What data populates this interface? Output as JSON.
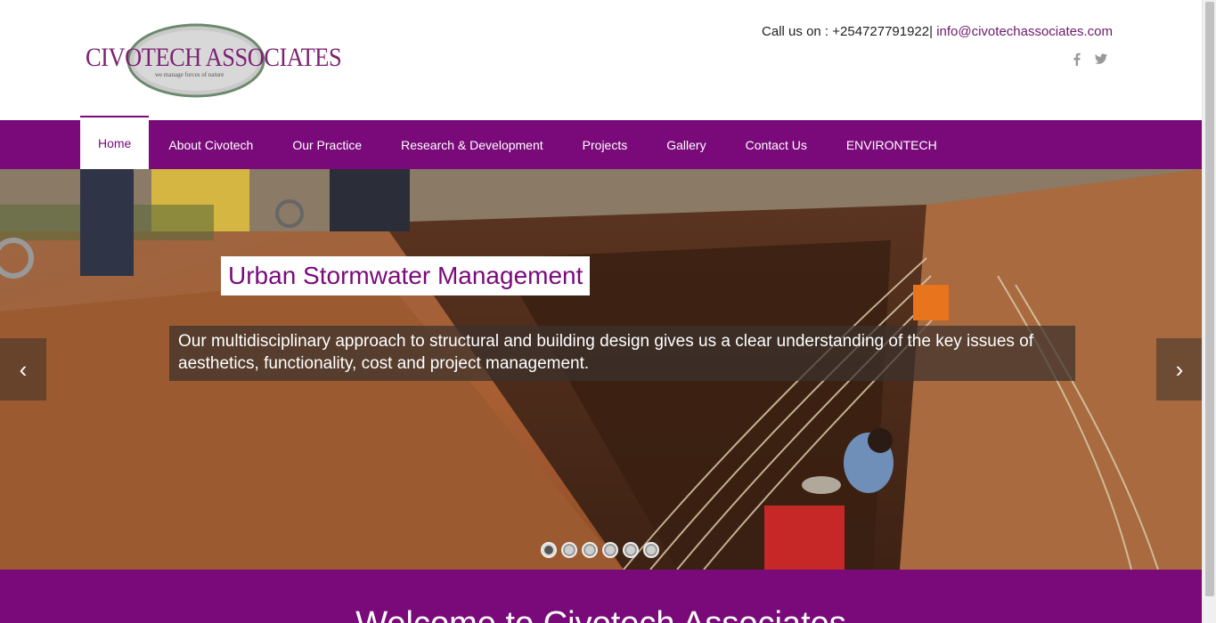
{
  "brand": {
    "logo_text": "CIVOTECH ASSOCIATES",
    "logo_tagline": "we manage forces of nature",
    "accent_color": "#7a0a7a"
  },
  "contact": {
    "prefix": "Call us on : +254727791922|",
    "email": "info@civotechassociates.com"
  },
  "socials": [
    {
      "icon": "facebook-icon"
    },
    {
      "icon": "twitter-icon"
    }
  ],
  "nav": {
    "items": [
      {
        "label": "Home",
        "active": true
      },
      {
        "label": "About Civotech"
      },
      {
        "label": "Our Practice"
      },
      {
        "label": "Research & Development"
      },
      {
        "label": "Projects"
      },
      {
        "label": "Gallery"
      },
      {
        "label": "Contact Us"
      },
      {
        "label": "ENVIRONTECH"
      }
    ]
  },
  "slider": {
    "title": "Urban Stormwater Management",
    "caption": "Our multidisciplinary approach to structural and building design gives us a clear understanding of the key issues of aesthetics, functionality, cost and project management.",
    "prev_icon": "‹",
    "next_icon": "›",
    "slide_count": 6,
    "active_index": 0
  },
  "welcome": {
    "heading": "Welcome to Civotech Associates"
  }
}
